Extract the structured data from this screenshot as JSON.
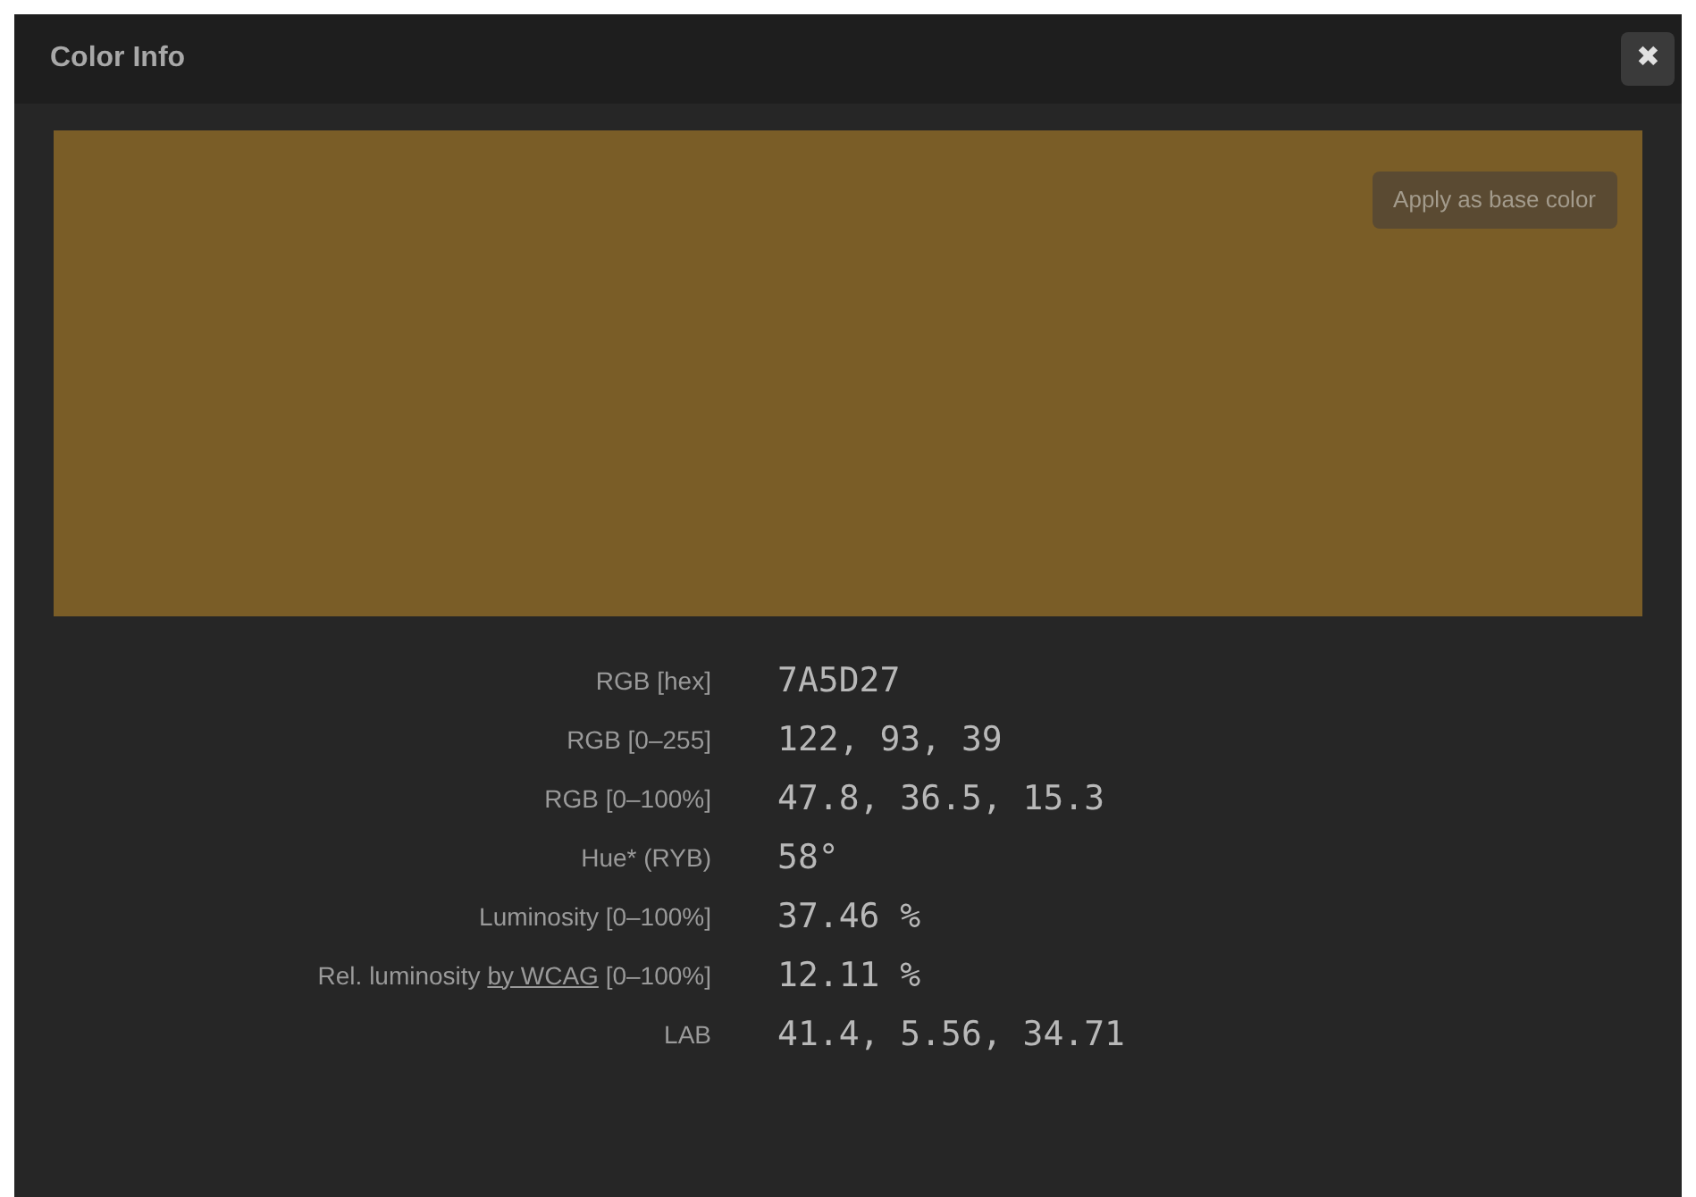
{
  "window": {
    "title": "Color Info",
    "close": "✖"
  },
  "swatch": {
    "color": "#7a5d27",
    "button": "Apply as base color"
  },
  "rows": [
    {
      "label": "RGB [hex]",
      "value": "7A5D27"
    },
    {
      "label": "RGB [0–255]",
      "value": "122, 93, 39"
    },
    {
      "label": "RGB [0–100%]",
      "value": "47.8, 36.5, 15.3"
    },
    {
      "label": "Hue* (RYB)",
      "value": "58°"
    },
    {
      "label": "Luminosity [0–100%]",
      "value": "37.46 %"
    },
    {
      "label": "Rel. luminosity ",
      "link": "by WCAG",
      "label_suffix": " [0–100%]",
      "value": "12.11 %"
    },
    {
      "label": "LAB",
      "value": "41.4, 5.56, 34.71"
    }
  ]
}
